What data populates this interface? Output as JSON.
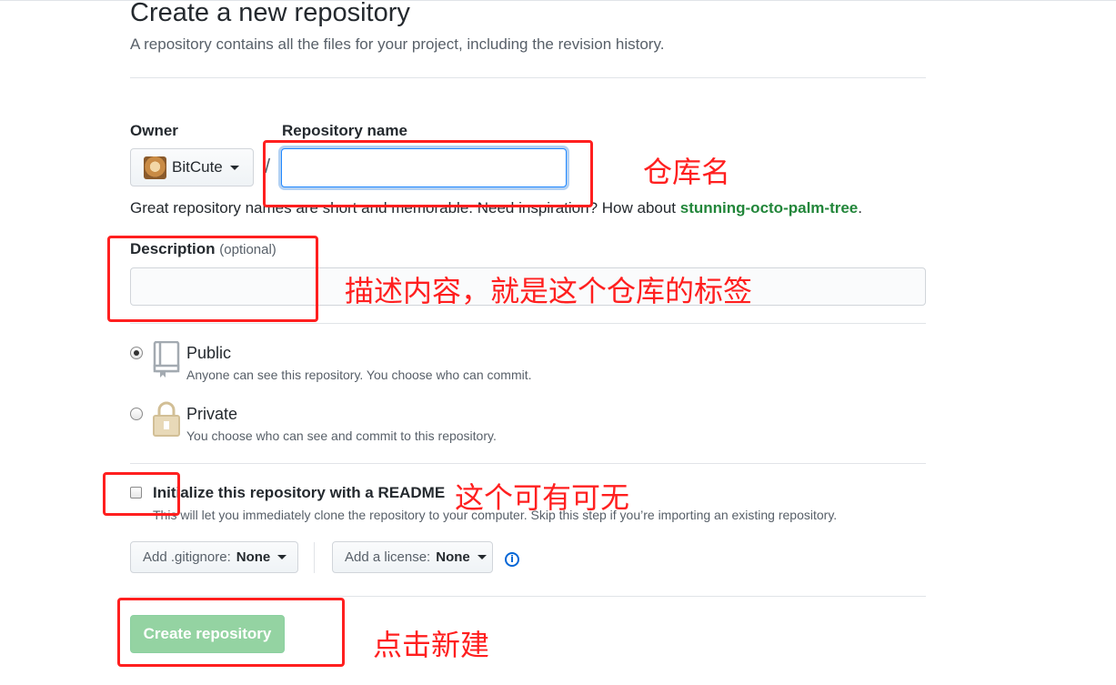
{
  "page": {
    "title": "Create a new repository",
    "subtitle": "A repository contains all the files for your project, including the revision history."
  },
  "owner": {
    "label": "Owner",
    "name": "BitCute"
  },
  "repo": {
    "label": "Repository name",
    "separator": "/",
    "value": "",
    "hint_prefix": "Great repository names are short and memorable. Need inspiration? How about ",
    "hint_suggestion": "stunning-octo-palm-tree",
    "hint_suffix": "."
  },
  "description": {
    "label": "Description",
    "optional": "(optional)",
    "value": ""
  },
  "visibility": {
    "selected": "public",
    "public_title": "Public",
    "public_note": "Anyone can see this repository. You choose who can commit.",
    "private_title": "Private",
    "private_note": "You choose who can see and commit to this repository."
  },
  "readme": {
    "label": "Initialize this repository with a README",
    "note": "This will let you immediately clone the repository to your computer. Skip this step if you’re importing an existing repository.",
    "checked": false
  },
  "gitignore": {
    "prefix": "Add .gitignore:",
    "value": "None"
  },
  "license": {
    "prefix": "Add a license:",
    "value": "None"
  },
  "create_button": "Create repository",
  "annotations": {
    "repo_name": "仓库名",
    "description": "描述内容，就是这个仓库的标签",
    "readme": "这个可有可无",
    "create": "点击新建",
    "color": "#ff1f1f"
  }
}
